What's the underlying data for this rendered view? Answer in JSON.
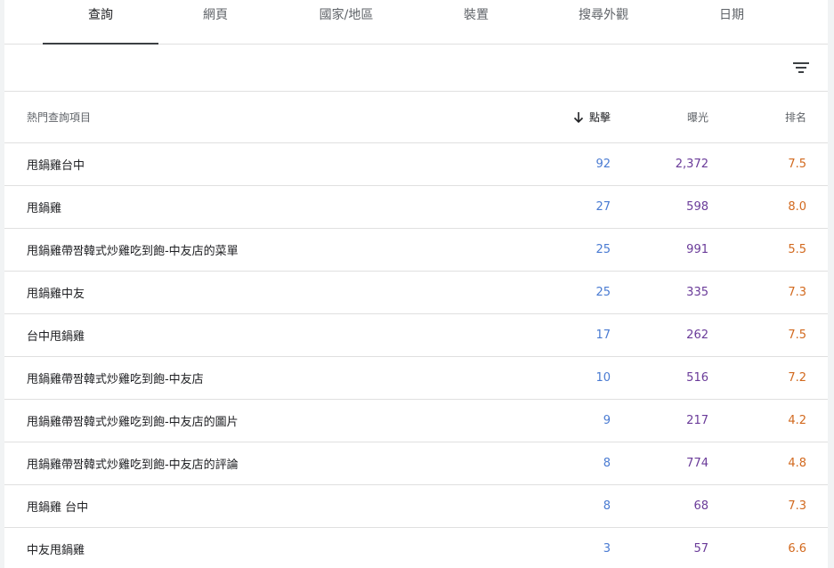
{
  "tabs": [
    {
      "label": "查詢",
      "active": true
    },
    {
      "label": "網頁",
      "active": false
    },
    {
      "label": "國家/地區",
      "active": false
    },
    {
      "label": "裝置",
      "active": false
    },
    {
      "label": "搜尋外觀",
      "active": false
    },
    {
      "label": "日期",
      "active": false
    }
  ],
  "toolbar": {
    "filter_icon": "filter-list-icon"
  },
  "table": {
    "headers": {
      "query": "熱門查詢項目",
      "clicks": "點擊",
      "impressions": "曝光",
      "position": "排名"
    },
    "sort_icon": "arrow-down-icon",
    "rows": [
      {
        "query": "甩鍋雞台中",
        "clicks": "92",
        "impressions": "2,372",
        "position": "7.5"
      },
      {
        "query": "甩鍋雞",
        "clicks": "27",
        "impressions": "598",
        "position": "8.0"
      },
      {
        "query": "甩鍋雞帶짬韓式炒雞吃到飽-中友店的菜單",
        "clicks": "25",
        "impressions": "991",
        "position": "5.5"
      },
      {
        "query": "甩鍋雞中友",
        "clicks": "25",
        "impressions": "335",
        "position": "7.3"
      },
      {
        "query": "台中甩鍋雞",
        "clicks": "17",
        "impressions": "262",
        "position": "7.5"
      },
      {
        "query": "甩鍋雞帶짬韓式炒雞吃到飽-中友店",
        "clicks": "10",
        "impressions": "516",
        "position": "7.2"
      },
      {
        "query": "甩鍋雞帶짬韓式炒雞吃到飽-中友店的圖片",
        "clicks": "9",
        "impressions": "217",
        "position": "4.2"
      },
      {
        "query": "甩鍋雞帶짬韓式炒雞吃到飽-中友店的評論",
        "clicks": "8",
        "impressions": "774",
        "position": "4.8"
      },
      {
        "query": "甩鍋雞 台中",
        "clicks": "8",
        "impressions": "68",
        "position": "7.3"
      },
      {
        "query": "中友甩鍋雞",
        "clicks": "3",
        "impressions": "57",
        "position": "6.6"
      }
    ]
  },
  "colors": {
    "clicks": "#4a7bd2",
    "impressions": "#6a3b99",
    "position": "#d2691e"
  }
}
